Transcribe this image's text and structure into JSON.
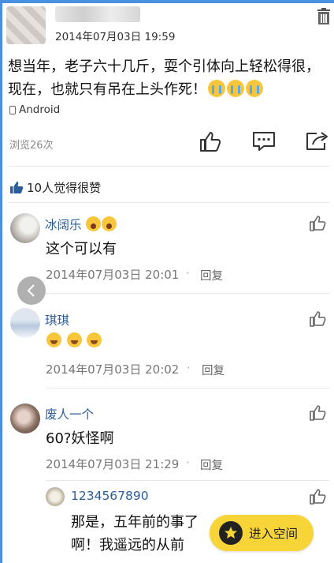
{
  "post": {
    "time": "2014年07月03日 19:59",
    "text": "想当年，老子六十几斤，耍个引体向上轻松得很，现在，也就只有吊在上头作死！",
    "platform": "Android",
    "views": "浏览26次"
  },
  "likes": {
    "summary": "10人觉得很赞"
  },
  "comments": [
    {
      "name": "冰阔乐",
      "text": "这个可以有",
      "time": "2014年07月03日 20:01",
      "reply": "回复"
    },
    {
      "name": "琪琪",
      "text": "",
      "time": "2014年07月03日 20:02",
      "reply": "回复"
    },
    {
      "name": "废人一个",
      "text": "60?妖怪啊",
      "time": "2014年07月03日 21:29",
      "reply": "回复"
    }
  ],
  "subreply": {
    "name": "1234567890",
    "line1": "那是，五年前的事了",
    "line2": "啊！我遥远的从前"
  },
  "enter_space": {
    "label": "进入空间"
  },
  "icons": {
    "trash": "trash-icon",
    "like": "thumbs-up-icon",
    "comment": "comment-icon",
    "share": "share-icon",
    "back": "chevron-left-icon",
    "star": "star-icon"
  },
  "colors": {
    "name_blue": "#2b5d9b",
    "button_yellow": "#f7d437",
    "frame_blue": "#4a8fe0"
  }
}
